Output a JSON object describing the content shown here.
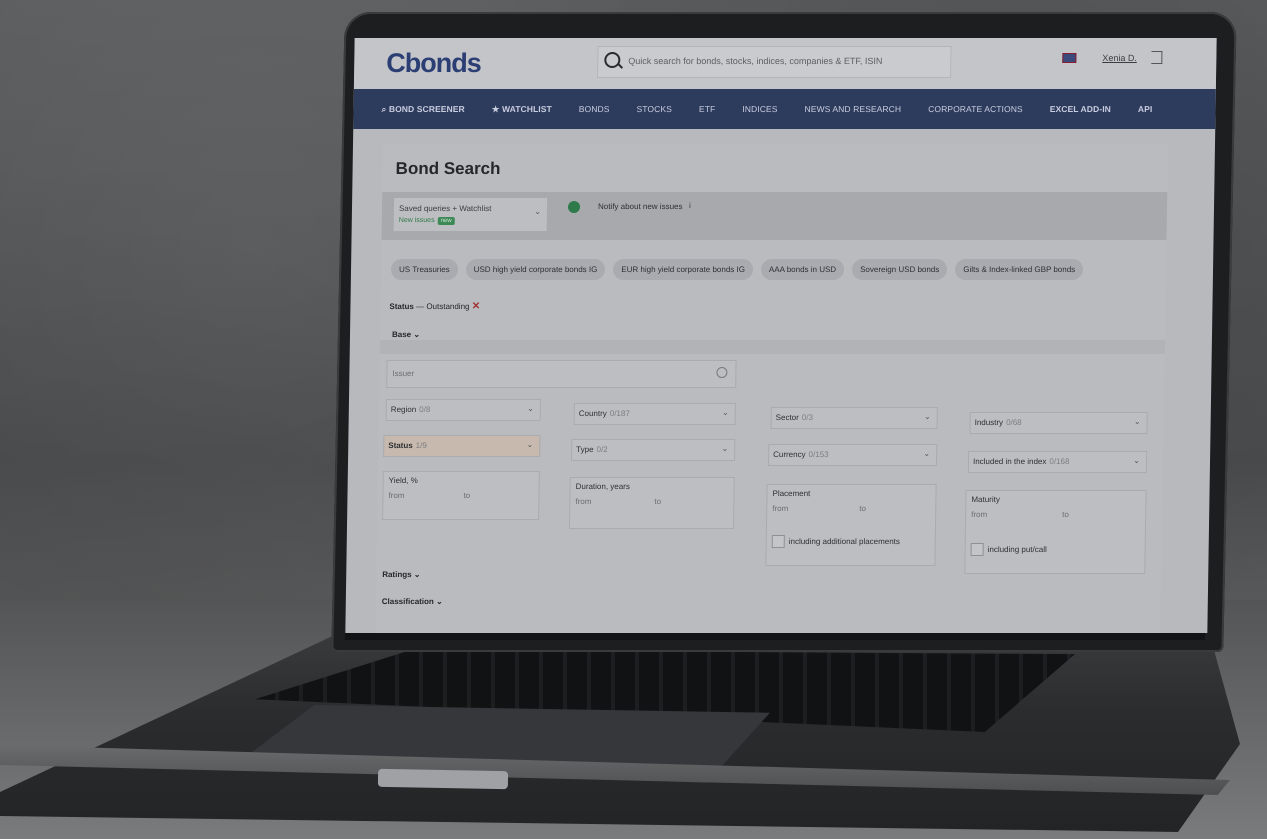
{
  "header": {
    "logo": "Cbonds",
    "search_placeholder": "Quick search for bonds, stocks, indices, companies & ETF, ISIN",
    "user_name": "Xenia D."
  },
  "nav": {
    "items": [
      {
        "label": "⌕ BOND SCREENER"
      },
      {
        "label": "★ WATCHLIST"
      },
      {
        "label": "BONDS"
      },
      {
        "label": "STOCKS"
      },
      {
        "label": "ETF"
      },
      {
        "label": "INDICES"
      },
      {
        "label": "NEWS AND RESEARCH"
      },
      {
        "label": "CORPORATE ACTIONS"
      },
      {
        "label": "EXCEL ADD-IN"
      },
      {
        "label": "API"
      }
    ]
  },
  "page": {
    "title": "Bond Search",
    "saved_queries": "Saved queries + Watchlist",
    "new_issues": "New issues",
    "new_badge": "new",
    "notify_label": "Notify about new issues",
    "presets": [
      "US Treasuries",
      "USD high yield corporate bonds IG",
      "EUR high yield corporate bonds IG",
      "AAA bonds in USD",
      "Sovereign USD bonds",
      "Gilts & Index-linked GBP bonds"
    ],
    "status_filter": {
      "label": "Status",
      "value": "— Outstanding"
    },
    "sections": {
      "base": "Base",
      "ratings": "Ratings",
      "classification": "Classification"
    },
    "issuer_placeholder": "Issuer",
    "filters": {
      "region": {
        "label": "Region",
        "count": "0/8"
      },
      "status": {
        "label": "Status",
        "count": "1/9"
      },
      "country": {
        "label": "Country",
        "count": "0/187"
      },
      "type": {
        "label": "Type",
        "count": "0/2"
      },
      "sector": {
        "label": "Sector",
        "count": "0/3"
      },
      "currency": {
        "label": "Currency",
        "count": "0/153"
      },
      "industry": {
        "label": "Industry",
        "count": "0/68"
      },
      "index": {
        "label": "Included in the index",
        "count": "0/168"
      }
    },
    "ranges": {
      "yield": "Yield, %",
      "duration": "Duration, years",
      "placement": "Placement",
      "maturity": "Maturity",
      "from": "from",
      "to": "to",
      "additional_placements": "including additional placements",
      "put_call": "including put/call"
    }
  }
}
